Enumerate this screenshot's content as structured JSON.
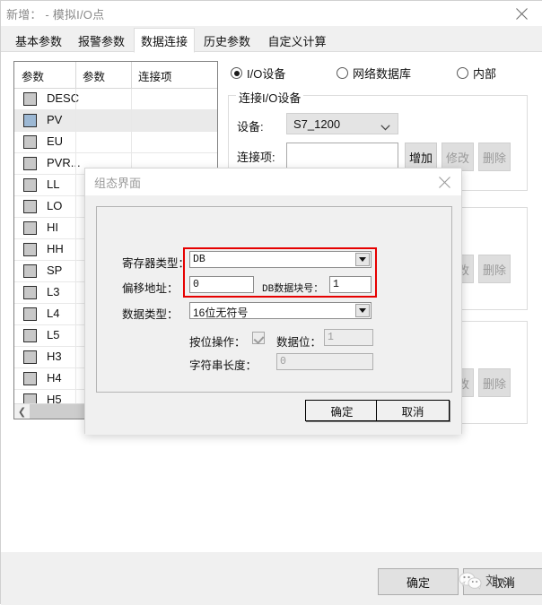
{
  "window": {
    "title": "新增： - 模拟I/O点",
    "close_icon": "close-icon"
  },
  "tabs": [
    {
      "label": "基本参数",
      "active": false
    },
    {
      "label": "报警参数",
      "active": false
    },
    {
      "label": "数据连接",
      "active": true
    },
    {
      "label": "历史参数",
      "active": false
    },
    {
      "label": "自定义计算",
      "active": false
    }
  ],
  "param_list": {
    "columns": [
      "参数",
      "参数",
      "连接项"
    ],
    "rows": [
      {
        "name": "DESC",
        "selected": false
      },
      {
        "name": "PV",
        "selected": true
      },
      {
        "name": "EU",
        "selected": false
      },
      {
        "name": "PVR...",
        "selected": false
      },
      {
        "name": "LL",
        "selected": false
      },
      {
        "name": "LO",
        "selected": false
      },
      {
        "name": "HI",
        "selected": false
      },
      {
        "name": "HH",
        "selected": false
      },
      {
        "name": "SP",
        "selected": false
      },
      {
        "name": "L3",
        "selected": false
      },
      {
        "name": "L4",
        "selected": false
      },
      {
        "name": "L5",
        "selected": false
      },
      {
        "name": "H3",
        "selected": false
      },
      {
        "name": "H4",
        "selected": false
      },
      {
        "name": "H5",
        "selected": false
      }
    ],
    "scroll_left_arrow": "chevron-left-icon"
  },
  "source": {
    "options": [
      {
        "label": "I/O设备",
        "checked": true
      },
      {
        "label": "网络数据库",
        "checked": false
      },
      {
        "label": "内部",
        "checked": false
      }
    ]
  },
  "io_group": {
    "title": "连接I/O设备",
    "device_label": "设备:",
    "device_value": "S7_1200",
    "connection_label": "连接项:",
    "connection_value": "",
    "buttons": {
      "add": "增加",
      "modify": "修改",
      "delete": "删除"
    }
  },
  "group2": {
    "buttons": {
      "modify": "修改",
      "delete": "删除"
    }
  },
  "group3": {
    "buttons": {
      "modify": "修改",
      "delete": "删除"
    }
  },
  "modal": {
    "title": "组态界面",
    "close_icon": "close-icon",
    "fields": {
      "register_type_label": "寄存器类型：",
      "register_type_value": "DB",
      "offset_label": "偏移地址：",
      "offset_value": "0",
      "db_block_label": "DB数据块号：",
      "db_block_value": "1",
      "data_type_label": "数据类型：",
      "data_type_value": "16位无符号",
      "bit_op_label": "按位操作：",
      "bit_op_checked": true,
      "data_bit_label": "数据位：",
      "data_bit_value": "1",
      "string_len_label": "字符串长度：",
      "string_len_value": "0"
    },
    "ok_label": "确定",
    "cancel_label": "取消"
  },
  "footer": {
    "ok_label": "确定",
    "cancel_label": "取消"
  },
  "watermark": {
    "icon": "wechat-icon",
    "text": "刘rui"
  },
  "colors": {
    "accent_red": "#e60000",
    "selection": "#9cb8d4",
    "window_bg": "#f0f0f0"
  }
}
